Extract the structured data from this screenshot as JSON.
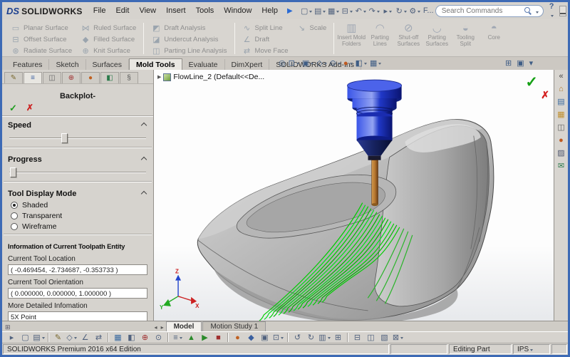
{
  "window": {
    "logo_ds": "DS",
    "logo_brand": "SOLIDWORKS",
    "menus": [
      {
        "name": "menu-file",
        "label": "File"
      },
      {
        "name": "menu-edit",
        "label": "Edit"
      },
      {
        "name": "menu-view",
        "label": "View"
      },
      {
        "name": "menu-insert",
        "label": "Insert"
      },
      {
        "name": "menu-tools",
        "label": "Tools"
      },
      {
        "name": "menu-window",
        "label": "Window"
      },
      {
        "name": "menu-help",
        "label": "Help"
      }
    ],
    "pin_glyph": "▶",
    "toolbar": [
      {
        "name": "new-button",
        "glyph": "▢",
        "dd": true
      },
      {
        "name": "open-button",
        "glyph": "▤",
        "dd": true
      },
      {
        "name": "save-button",
        "glyph": "▦",
        "dd": true
      },
      {
        "name": "print-button",
        "glyph": "⊟",
        "dd": true
      },
      {
        "name": "undo-button",
        "glyph": "↶",
        "dd": true
      },
      {
        "name": "redo-button",
        "glyph": "↷",
        "dd": true
      },
      {
        "name": "select-button",
        "glyph": "▸",
        "dd": true
      },
      {
        "name": "rebuild-button",
        "glyph": "↻",
        "dd": true
      },
      {
        "name": "options-button",
        "glyph": "⚙",
        "dd": true
      },
      {
        "name": "file-properties-button",
        "glyph": "F..."
      }
    ],
    "search_placeholder": "Search Commands",
    "help_glyph": "?"
  },
  "ribbon": {
    "col1": [
      {
        "name": "planar-surface-button",
        "glyph": "▭",
        "label": "Planar Surface"
      },
      {
        "name": "offset-surface-button",
        "glyph": "⊟",
        "label": "Offset Surface"
      },
      {
        "name": "radiate-surface-button",
        "glyph": "⊛",
        "label": "Radiate Surface"
      }
    ],
    "col2": [
      {
        "name": "ruled-surface-button",
        "glyph": "⋈",
        "label": "Ruled Surface"
      },
      {
        "name": "filled-surface-button",
        "glyph": "◆",
        "label": "Filled Surface"
      },
      {
        "name": "knit-surface-button",
        "glyph": "⊕",
        "label": "Knit Surface"
      }
    ],
    "col3": [
      {
        "name": "draft-analysis-button",
        "glyph": "◩",
        "label": "Draft Analysis"
      },
      {
        "name": "undercut-analysis-button",
        "glyph": "◪",
        "label": "Undercut Analysis"
      },
      {
        "name": "parting-line-analysis-button",
        "glyph": "◫",
        "label": "Parting Line Analysis"
      }
    ],
    "col4": [
      {
        "name": "split-line-button",
        "glyph": "∿",
        "label": "Split Line"
      },
      {
        "name": "draft-button",
        "glyph": "∠",
        "label": "Draft"
      },
      {
        "name": "move-face-button",
        "glyph": "⇄",
        "label": "Move Face"
      }
    ],
    "col5": [
      {
        "name": "scale-button",
        "glyph": "↘",
        "label": "Scale"
      }
    ],
    "large": [
      {
        "name": "insert-mold-folders-button",
        "glyph": "▥",
        "label": "Insert Mold Folders"
      },
      {
        "name": "parting-lines-button",
        "glyph": "◠",
        "label": "Parting Lines"
      },
      {
        "name": "shut-off-surfaces-button",
        "glyph": "⊘",
        "label": "Shut-off Surfaces"
      },
      {
        "name": "parting-surfaces-button",
        "glyph": "◡",
        "label": "Parting Surfaces"
      },
      {
        "name": "tooling-split-button",
        "glyph": "◒",
        "label": "Tooling Split"
      },
      {
        "name": "core-button",
        "glyph": "◓",
        "label": "Core"
      }
    ]
  },
  "tabs": [
    "Features",
    "Sketch",
    "Surfaces",
    "Mold Tools",
    "Evaluate",
    "DimXpert",
    "SOLIDWORKS Add-Ins"
  ],
  "headsup": [
    {
      "name": "zoom-fit-icon",
      "glyph": "◎"
    },
    {
      "name": "zoom-area-icon",
      "glyph": "⊡",
      "dd": true
    },
    {
      "name": "view-orientation-icon",
      "glyph": "▣",
      "dd": true
    },
    {
      "name": "display-style-icon",
      "glyph": "◇",
      "dd": true
    },
    {
      "name": "hide-show-items-icon",
      "glyph": "⊙",
      "dd": true
    },
    {
      "name": "edit-appearance-icon",
      "glyph": "●",
      "color": "#c05a20",
      "dd": true
    },
    {
      "name": "apply-scene-icon",
      "glyph": "◧",
      "dd": true
    },
    {
      "name": "view-settings-icon",
      "glyph": "▦",
      "dd": true
    }
  ],
  "headsup_right": [
    {
      "name": "fullscreen-icon",
      "glyph": "⊞"
    },
    {
      "name": "undock-icon",
      "glyph": "▣"
    },
    {
      "name": "more-options-icon",
      "glyph": "▾"
    }
  ],
  "panel": {
    "tabs": [
      {
        "name": "backplot-tab",
        "glyph": "✎",
        "color": "#7a6a30"
      },
      {
        "name": "property-manager-tab",
        "glyph": "≡",
        "color": "#3a5f9f",
        "active": true
      },
      {
        "name": "configuration-manager-tab",
        "glyph": "◫",
        "color": "#666666"
      },
      {
        "name": "dimxpert-manager-tab",
        "glyph": "⊕",
        "color": "#a03030"
      },
      {
        "name": "appearances-tab",
        "glyph": "●",
        "color": "#c06020"
      },
      {
        "name": "scene-tab",
        "glyph": "◧",
        "color": "#2a7a4a"
      },
      {
        "name": "attachments-tab",
        "glyph": "§",
        "color": "#555555"
      }
    ],
    "title": "Backplot-",
    "ok_glyph": "✓",
    "cancel_glyph": "✗",
    "speed_label": "Speed",
    "progress_label": "Progress",
    "display_label": "Tool Display Mode",
    "display_options": [
      "Shaded",
      "Transparent",
      "Wireframe"
    ],
    "info_title": "Information of Current Toolpath Entity",
    "loc_label": "Current Tool Location",
    "loc_value": "( -0.469454, -2.734687, -0.353733 )",
    "ori_label": "Current Tool Orientation",
    "ori_value": "( 0.000000, 0.000000, 1.000000 )",
    "more_label": "More Detailed Infomation",
    "more_value": "5X Point"
  },
  "viewport": {
    "tree_expander": "▶",
    "tree_item": "FlowLine_2 (Default<<De...",
    "ok_glyph": "✓",
    "cancel_glyph": "✗",
    "triad": {
      "x": "X",
      "y": "Y",
      "z": "Z"
    }
  },
  "rightstrip": [
    {
      "name": "collapse-taskpane-icon",
      "glyph": "«",
      "color": "#444444"
    },
    {
      "name": "resources-icon",
      "glyph": "⌂",
      "color": "#b07828"
    },
    {
      "name": "design-library-icon",
      "glyph": "▤",
      "color": "#3a6aa0"
    },
    {
      "name": "file-explorer-icon",
      "glyph": "▦",
      "color": "#c09030"
    },
    {
      "name": "view-palette-icon",
      "glyph": "◫",
      "color": "#666666"
    },
    {
      "name": "appearances-strip-icon",
      "glyph": "●",
      "color": "#c05a20"
    },
    {
      "name": "custom-properties-icon",
      "glyph": "▨",
      "color": "#505870"
    },
    {
      "name": "forum-icon",
      "glyph": "✉",
      "color": "#2a7a4a"
    }
  ],
  "modeltabs": {
    "split_glyph": "⊞",
    "left_glyph": "◂",
    "right_glyph": "▸",
    "tabs": [
      "Model",
      "Motion Study 1"
    ]
  },
  "cam_toolbar": [
    {
      "name": "select-tool-icon",
      "glyph": "▸"
    },
    {
      "name": "new-operation-icon",
      "glyph": "▢"
    },
    {
      "name": "open-setup-icon",
      "glyph": "▤",
      "dd": true
    },
    {
      "sep": true
    },
    {
      "name": "sketch-icon",
      "glyph": "✎",
      "color": "#7a6a30"
    },
    {
      "name": "geometry-icon",
      "glyph": "◇",
      "dd": true
    },
    {
      "name": "angle-measure-icon",
      "glyph": "∠"
    },
    {
      "name": "mirror-icon",
      "glyph": "⇄"
    },
    {
      "sep": true
    },
    {
      "name": "stock-icon",
      "glyph": "▦",
      "color": "#3a6aa0"
    },
    {
      "name": "target-part-icon",
      "glyph": "◧"
    },
    {
      "name": "coordinate-system-icon",
      "glyph": "⊕",
      "color": "#a03030"
    },
    {
      "name": "tool-table-icon",
      "glyph": "⊙"
    },
    {
      "sep": true
    },
    {
      "name": "operations-tree-icon",
      "glyph": "≡",
      "dd": true
    },
    {
      "name": "simulate-icon",
      "glyph": "▲",
      "color": "#2a8a2a"
    },
    {
      "name": "play-icon",
      "glyph": "▶",
      "color": "#2a8a2a"
    },
    {
      "name": "stop-icon",
      "glyph": "■",
      "color": "#a03030"
    },
    {
      "sep": true
    },
    {
      "name": "appearance-icon",
      "glyph": "●",
      "color": "#c06020"
    },
    {
      "name": "material-icon",
      "glyph": "◆",
      "color": "#3a5f9f"
    },
    {
      "name": "section-view-icon",
      "glyph": "▣"
    },
    {
      "name": "zoom-tool-icon",
      "glyph": "⊡",
      "dd": true
    },
    {
      "sep": true
    },
    {
      "name": "undo-cam-icon",
      "glyph": "↺"
    },
    {
      "name": "redo-cam-icon",
      "glyph": "↻"
    },
    {
      "name": "library-icon",
      "glyph": "▥",
      "dd": true
    },
    {
      "name": "grid-icon",
      "glyph": "⊞"
    },
    {
      "sep": true
    },
    {
      "name": "report-icon",
      "glyph": "⊟"
    },
    {
      "name": "compare-icon",
      "glyph": "◫"
    },
    {
      "name": "hatch-icon",
      "glyph": "▧"
    },
    {
      "name": "delete-icon",
      "glyph": "⊠",
      "dd": true
    }
  ],
  "status": {
    "brand": "SOLIDWORKS Premium 2016 x64 Edition",
    "editing": "Editing Part",
    "units": "IPS"
  },
  "colors": {
    "accent_blue": "#3d6ab5",
    "tool_blue": "#1a2cb0",
    "tool_shank": "#a86428",
    "toolpath_green": "#00cc00",
    "ok_green": "#15a015",
    "cancel_red": "#d42020"
  }
}
